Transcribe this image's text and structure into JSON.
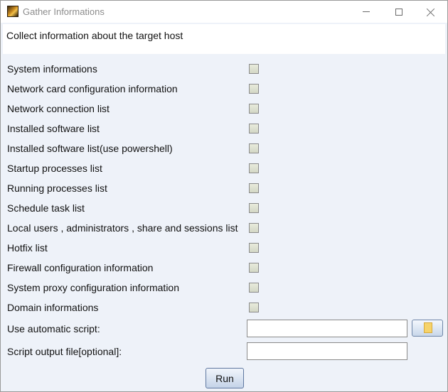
{
  "window": {
    "title": "Gather Informations",
    "app_icon": "app-logo-icon",
    "controls": {
      "minimize": "minimize-icon",
      "maximize": "maximize-icon",
      "close": "close-icon"
    }
  },
  "description": "Collect information about the target host",
  "options": [
    {
      "label": "System informations",
      "checked": false
    },
    {
      "label": "Network card configuration information",
      "checked": false
    },
    {
      "label": "Network connection list",
      "checked": false
    },
    {
      "label": "Installed software list",
      "checked": false
    },
    {
      "label": "Installed software list(use powershell)",
      "checked": false
    },
    {
      "label": "Startup processes list",
      "checked": false
    },
    {
      "label": "Running processes list",
      "checked": false
    },
    {
      "label": "Schedule task list",
      "checked": false
    },
    {
      "label": "Local users , administrators , share and sessions list",
      "checked": false
    },
    {
      "label": "Hotfix list",
      "checked": false
    },
    {
      "label": "Firewall configuration information",
      "checked": false
    },
    {
      "label": "System proxy configuration information",
      "checked": false
    },
    {
      "label": "Domain informations",
      "checked": false
    }
  ],
  "script_field": {
    "label": "Use automatic script:",
    "value": "",
    "browse_icon": "folder-icon"
  },
  "output_field": {
    "label": "Script output file[optional]:",
    "value": ""
  },
  "run_button": {
    "label": "Run"
  }
}
